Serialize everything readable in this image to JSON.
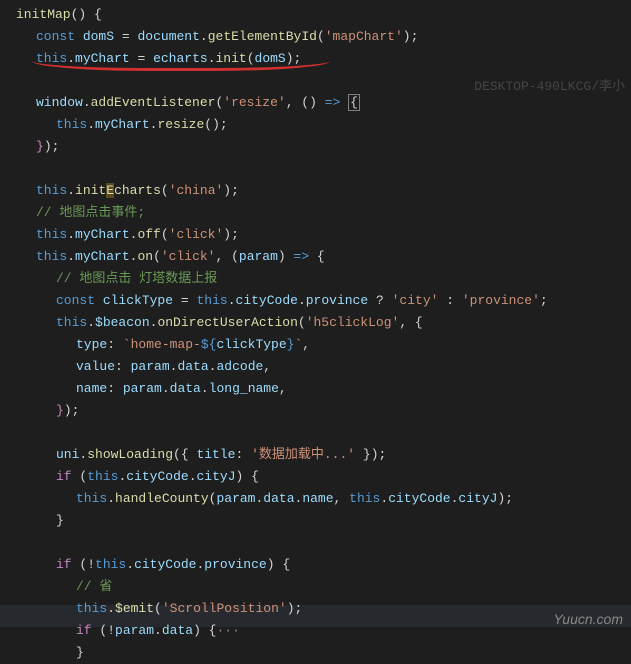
{
  "watermarks": {
    "top": "DESKTOP-490LKCG/李小",
    "bottom": "Yuucn.com"
  },
  "code": {
    "l01_fn": "initMap",
    "l02_kw": "const",
    "l02_var": "domS",
    "l02_obj": "document",
    "l02_fn": "getElementById",
    "l02_str": "'mapChart'",
    "l03_this": "this",
    "l03_prop": "myChart",
    "l03_obj": "echarts",
    "l03_fn": "init",
    "l03_arg": "domS",
    "l04_obj": "window",
    "l04_fn": "addEventListener",
    "l04_str": "'resize'",
    "l05_this": "this",
    "l05_prop": "myChart",
    "l05_fn": "resize",
    "l08_this": "this",
    "l08_fn": "initEcharts",
    "l08_str": "'china'",
    "l08_hl": "E",
    "l09_cmt": "// 地图点击事件;",
    "l10_this": "this",
    "l10_prop": "myChart",
    "l10_fn": "off",
    "l10_str": "'click'",
    "l11_this": "this",
    "l11_prop": "myChart",
    "l11_fn": "on",
    "l11_str": "'click'",
    "l11_param": "param",
    "l12_cmt": "// 地图点击 灯塔数据上报",
    "l13_kw": "const",
    "l13_var": "clickType",
    "l13_this": "this",
    "l13_prop": "cityCode",
    "l13_prop2": "province",
    "l13_s1": "'city'",
    "l13_s2": "'province'",
    "l14_this": "this",
    "l14_prop": "$beacon",
    "l14_fn": "onDirectUserAction",
    "l14_str": "'h5clickLog'",
    "l15_key": "type",
    "l15_tpl1": "`home-map-",
    "l15_var": "clickType",
    "l15_tpl2": "`",
    "l16_key": "value",
    "l16_v": "param",
    "l16_p1": "data",
    "l16_p2": "adcode",
    "l17_key": "name",
    "l17_v": "param",
    "l17_p1": "data",
    "l17_p2": "long_name",
    "l20_obj": "uni",
    "l20_fn": "showLoading",
    "l20_key": "title",
    "l20_str": "'数据加载中...'",
    "l21_kw": "if",
    "l21_this": "this",
    "l21_prop": "cityCode",
    "l21_prop2": "cityJ",
    "l22_this": "this",
    "l22_fn": "handleCounty",
    "l22_v": "param",
    "l22_p1": "data",
    "l22_p2": "name",
    "l22_this2": "this",
    "l22_prop": "cityCode",
    "l22_prop2": "cityJ",
    "l25_kw": "if",
    "l25_this": "this",
    "l25_prop": "cityCode",
    "l25_prop2": "province",
    "l26_cmt": "// 省",
    "l27_this": "this",
    "l27_fn": "$emit",
    "l27_str": "'ScrollPosition'",
    "l28_kw": "if",
    "l28_v": "param",
    "l28_p": "data",
    "l28_fold": "···"
  }
}
